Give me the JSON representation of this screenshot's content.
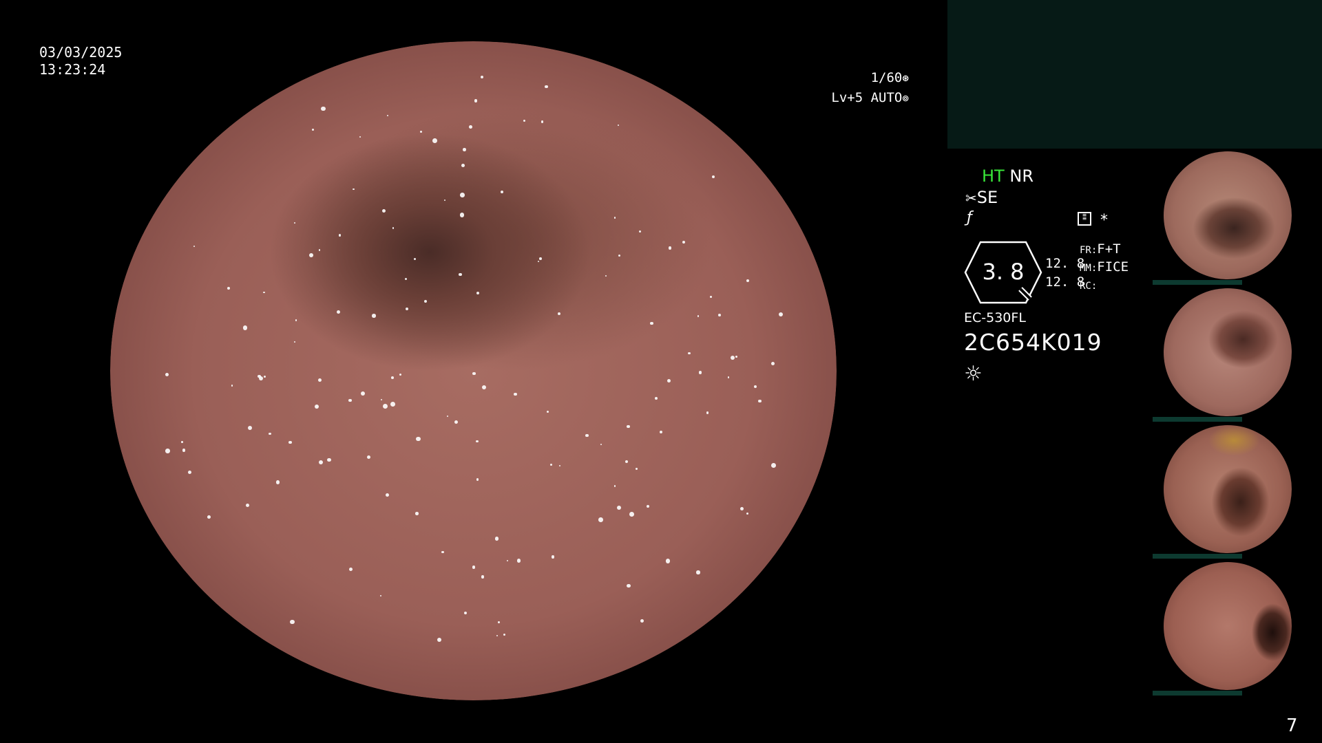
{
  "overlay": {
    "date": "03/03/2025",
    "time": "13:23:24",
    "shutter": "1/60",
    "level": "Lv+5",
    "mode": "AUTO"
  },
  "status": {
    "ht": "HT",
    "nr": "NR",
    "se": "SE",
    "zoom_value": "3. 8",
    "val1": "12. 8",
    "val2": "12. 8",
    "fr_label": "FR:",
    "fr_value": "F+T",
    "mm_label": "MM:",
    "mm_value": "FICE",
    "rc_label": "RC:",
    "scope_model": "EC-530FL",
    "serial": "2C654K019",
    "page_number": "7"
  },
  "colors": {
    "ht_green": "#39e639",
    "panel_dark_green": "#061a16",
    "thumb_bar": "#0d3a30"
  },
  "icons": {
    "shutter_icon": "aperture-icon",
    "auto_icon": "iris-icon",
    "se_icon": "scissors-icon",
    "f_icon": "slash-f-icon",
    "doc_icon": "document-icon",
    "star_icon": "asterisk-icon",
    "zoom_icon": "hexagon-gauge-icon",
    "light_icon": "sun-icon"
  }
}
